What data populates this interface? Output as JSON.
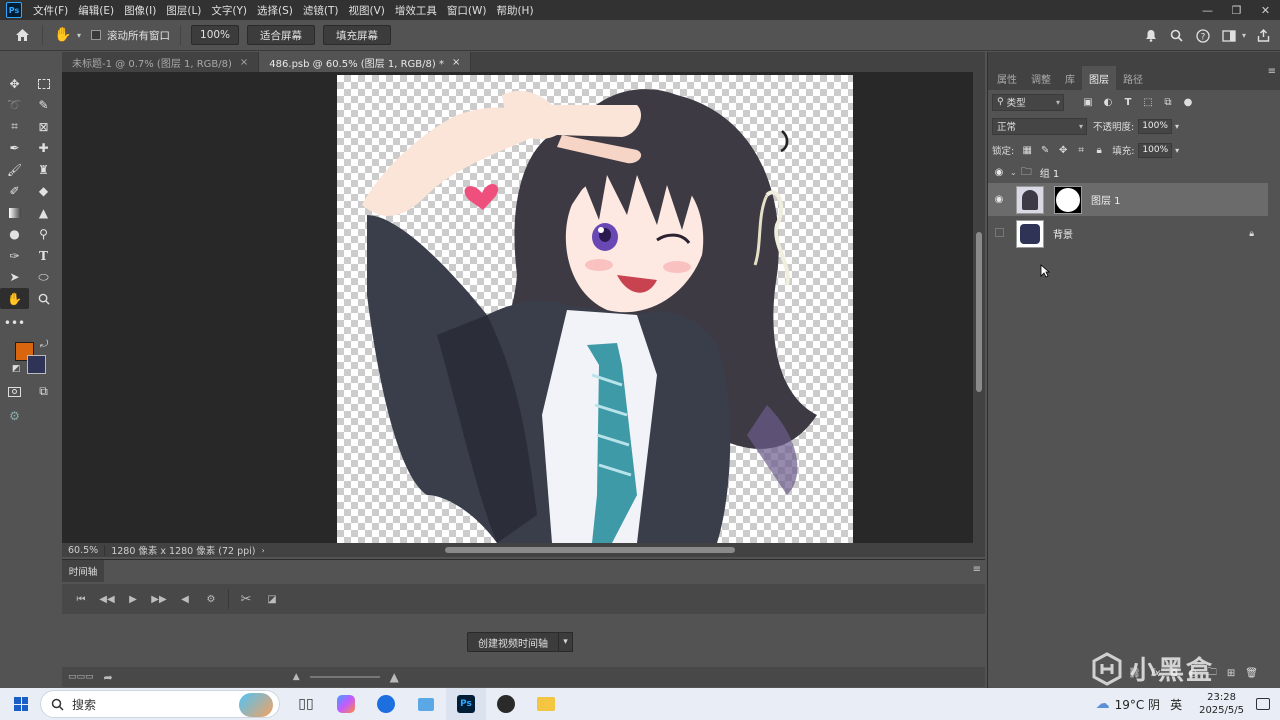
{
  "menubar": {
    "logo": "Ps",
    "items": [
      "文件(F)",
      "编辑(E)",
      "图像(I)",
      "图层(L)",
      "文字(Y)",
      "选择(S)",
      "滤镜(T)",
      "视图(V)",
      "增效工具",
      "窗口(W)",
      "帮助(H)"
    ]
  },
  "options": {
    "scroll_all_label": "滚动所有窗口",
    "zoom_value": "100%",
    "fit_screen": "适合屏幕",
    "fill_screen": "填充屏幕"
  },
  "doc_tabs": [
    {
      "label": "未标题-1 @ 0.7% (图层 1, RGB/8)",
      "close": "×"
    },
    {
      "label": "486.psb @ 60.5% (图层 1, RGB/8) *",
      "close": "×"
    }
  ],
  "status": {
    "zoom": "60.5%",
    "info": "1280 像素 x 1280 像素 (72 ppi)"
  },
  "timeline": {
    "tab": "时间轴",
    "create_button": "创建视频时间轴"
  },
  "panel": {
    "tabs": [
      "属性",
      "调整",
      "库",
      "图层",
      "路径"
    ],
    "filter_kind": "类型",
    "blend_mode": "正常",
    "opacity_label": "不透明度:",
    "opacity_value": "100%",
    "lock_label": "锁定:",
    "fill_label": "填充:",
    "fill_value": "100%",
    "layers": [
      {
        "name": "组 1"
      },
      {
        "name": "图层 1"
      },
      {
        "name": "背景"
      }
    ]
  },
  "taskbar": {
    "search_placeholder": "搜索",
    "weather": "19°C 阴",
    "ime": "英",
    "time": "23:28",
    "date": "2025/5/5"
  },
  "watermark": "小黑盒",
  "colors": {
    "foreground": "#d9660f",
    "background": "#2f3457"
  }
}
